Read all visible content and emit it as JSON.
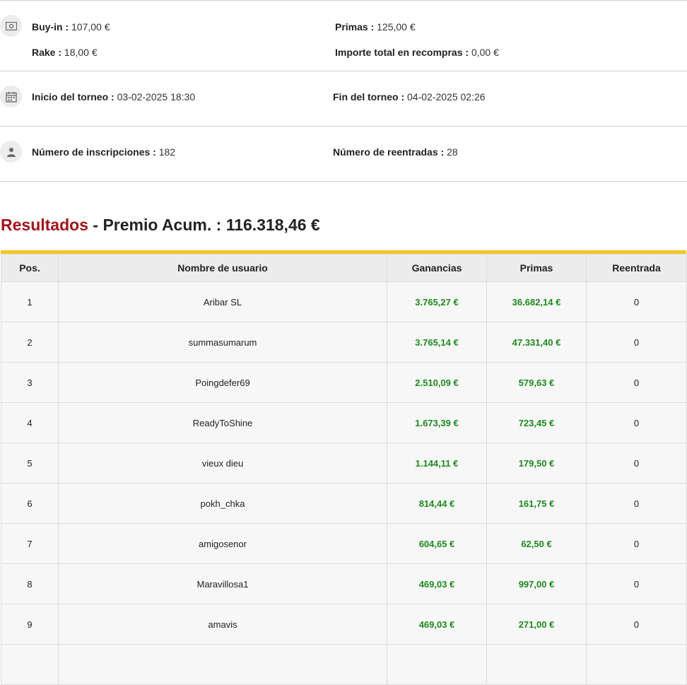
{
  "info": {
    "buyin_label": "Buy-in :",
    "buyin_value": "107,00 €",
    "rake_label": "Rake :",
    "rake_value": "18,00 €",
    "primas_label": "Primas :",
    "primas_value": "125,00 €",
    "recompras_label": "Importe total en recompras :",
    "recompras_value": "0,00 €",
    "inicio_label": "Inicio del torneo :",
    "inicio_value": "03-02-2025 18:30",
    "fin_label": "Fin del torneo :",
    "fin_value": "04-02-2025 02:26",
    "inscripciones_label": "Número de inscripciones :",
    "inscripciones_value": "182",
    "reentradas_label": "Número de reentradas :",
    "reentradas_value": "28"
  },
  "results": {
    "title": "Resultados",
    "separator": "-",
    "pool_label": "Premio Acum. :",
    "pool_value": "116.318,46 €"
  },
  "table": {
    "headers": [
      "Pos.",
      "Nombre de usuario",
      "Ganancias",
      "Primas",
      "Reentrada"
    ],
    "rows": [
      [
        "1",
        "Aribar SL",
        "3.765,27 €",
        "36.682,14 €",
        "0"
      ],
      [
        "2",
        "summasumarum",
        "3.765,14 €",
        "47.331,40 €",
        "0"
      ],
      [
        "3",
        "Poingdefer69",
        "2.510,09 €",
        "579,63 €",
        "0"
      ],
      [
        "4",
        "ReadyToShine",
        "1.673,39 €",
        "723,45 €",
        "0"
      ],
      [
        "5",
        "vieux dieu",
        "1.144,11 €",
        "179,50 €",
        "0"
      ],
      [
        "6",
        "pokh_chka",
        "814,44 €",
        "161,75 €",
        "0"
      ],
      [
        "7",
        "amigosenor",
        "604,65 €",
        "62,50 €",
        "0"
      ],
      [
        "8",
        "Maravillosa1",
        "469,03 €",
        "997,00 €",
        "0"
      ],
      [
        "9",
        "amavis",
        "469,03 €",
        "271,00 €",
        "0"
      ],
      [
        "",
        "",
        "",
        "",
        ""
      ]
    ]
  },
  "colors": {
    "accent_red": "#a3141b",
    "money_green": "#1c8a1c",
    "header_bar": "#f2c625"
  },
  "icons": {
    "money": "banknote-icon",
    "date": "calendar-icon",
    "users": "user-icon"
  }
}
